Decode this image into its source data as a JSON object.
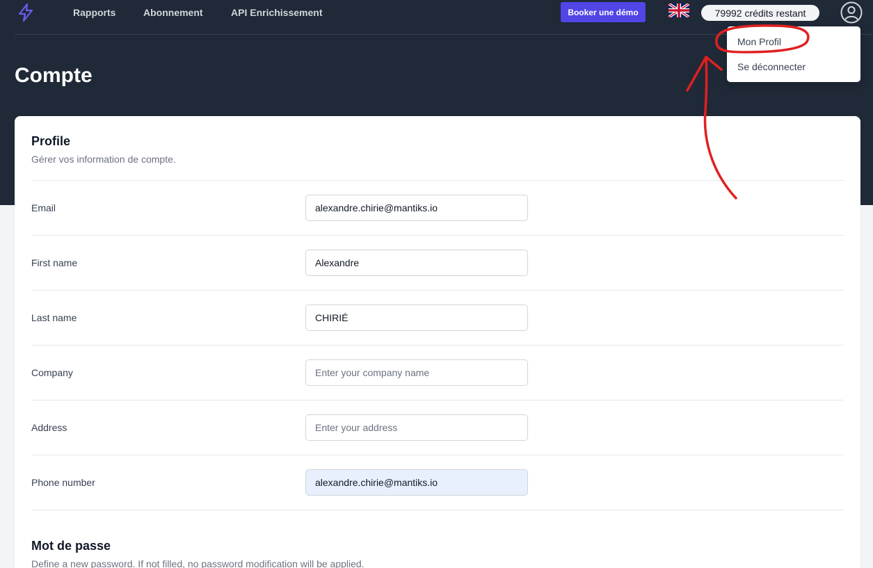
{
  "nav": {
    "items": [
      {
        "label": "Rapports"
      },
      {
        "label": "Abonnement"
      },
      {
        "label": "API Enrichissement"
      }
    ],
    "demo_button": "Booker une démo",
    "credits": "79992 crédits restant",
    "language_flag": "uk-flag-icon",
    "avatar_icon": "user-circle-icon",
    "logo_icon": "lightning-bolt-icon"
  },
  "dropdown": {
    "items": [
      {
        "label": "Mon Profil"
      },
      {
        "label": "Se déconnecter"
      }
    ]
  },
  "page": {
    "title": "Compte"
  },
  "profile": {
    "title": "Profile",
    "description": "Gérer vos information de compte.",
    "fields": [
      {
        "label": "Email",
        "value": "alexandre.chirie@mantiks.io",
        "placeholder": ""
      },
      {
        "label": "First name",
        "value": "Alexandre",
        "placeholder": ""
      },
      {
        "label": "Last name",
        "value": "CHIRIÉ",
        "placeholder": ""
      },
      {
        "label": "Company",
        "value": "",
        "placeholder": "Enter your company name"
      },
      {
        "label": "Address",
        "value": "",
        "placeholder": "Enter your address"
      },
      {
        "label": "Phone number",
        "value": "alexandre.chirie@mantiks.io",
        "placeholder": ""
      }
    ]
  },
  "password": {
    "title": "Mot de passe",
    "description": "Define a new password. If not filled, no password modification will be applied."
  },
  "colors": {
    "header_bg": "#1f2937",
    "accent": "#5145e5",
    "annotation": "#e02020",
    "autofill_bg": "#e8f0fe"
  }
}
